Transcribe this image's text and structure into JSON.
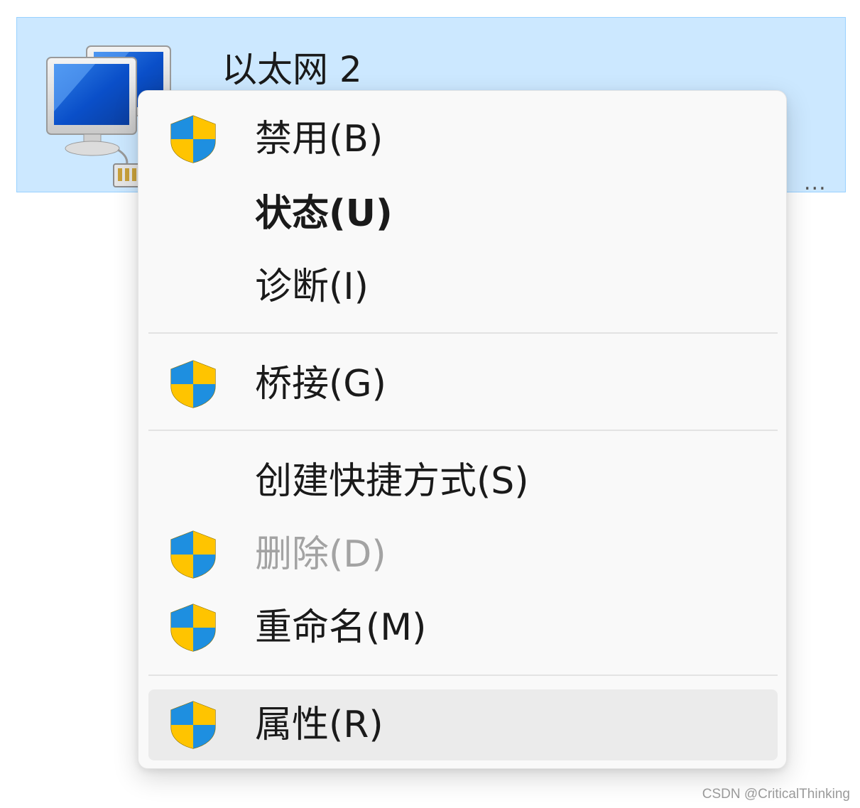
{
  "adapter": {
    "name": "以太网 2",
    "more_indicator": "...",
    "icon": "network-computers-icon",
    "selected_bg": "#cce8ff"
  },
  "context_menu": {
    "items": [
      {
        "label": "禁用(B)",
        "icon": "uac-shield-icon",
        "disabled": false,
        "bold": false
      },
      {
        "label": "状态(U)",
        "icon": null,
        "disabled": false,
        "bold": true
      },
      {
        "label": "诊断(I)",
        "icon": null,
        "disabled": false,
        "bold": false
      },
      {
        "label": "桥接(G)",
        "icon": "uac-shield-icon",
        "disabled": false,
        "bold": false
      },
      {
        "label": "创建快捷方式(S)",
        "icon": null,
        "disabled": false,
        "bold": false
      },
      {
        "label": "删除(D)",
        "icon": "uac-shield-icon",
        "disabled": true,
        "bold": false
      },
      {
        "label": "重命名(M)",
        "icon": "uac-shield-icon",
        "disabled": false,
        "bold": false
      },
      {
        "label": "属性(R)",
        "icon": "uac-shield-icon",
        "disabled": false,
        "bold": false,
        "hovered": true
      }
    ]
  },
  "colors": {
    "shield_blue": "#1e8fe0",
    "shield_yellow": "#ffc400",
    "hover_bg": "#ebebeb",
    "disabled_text": "#a3a3a3"
  },
  "watermark": "CSDN @CriticalThinking"
}
